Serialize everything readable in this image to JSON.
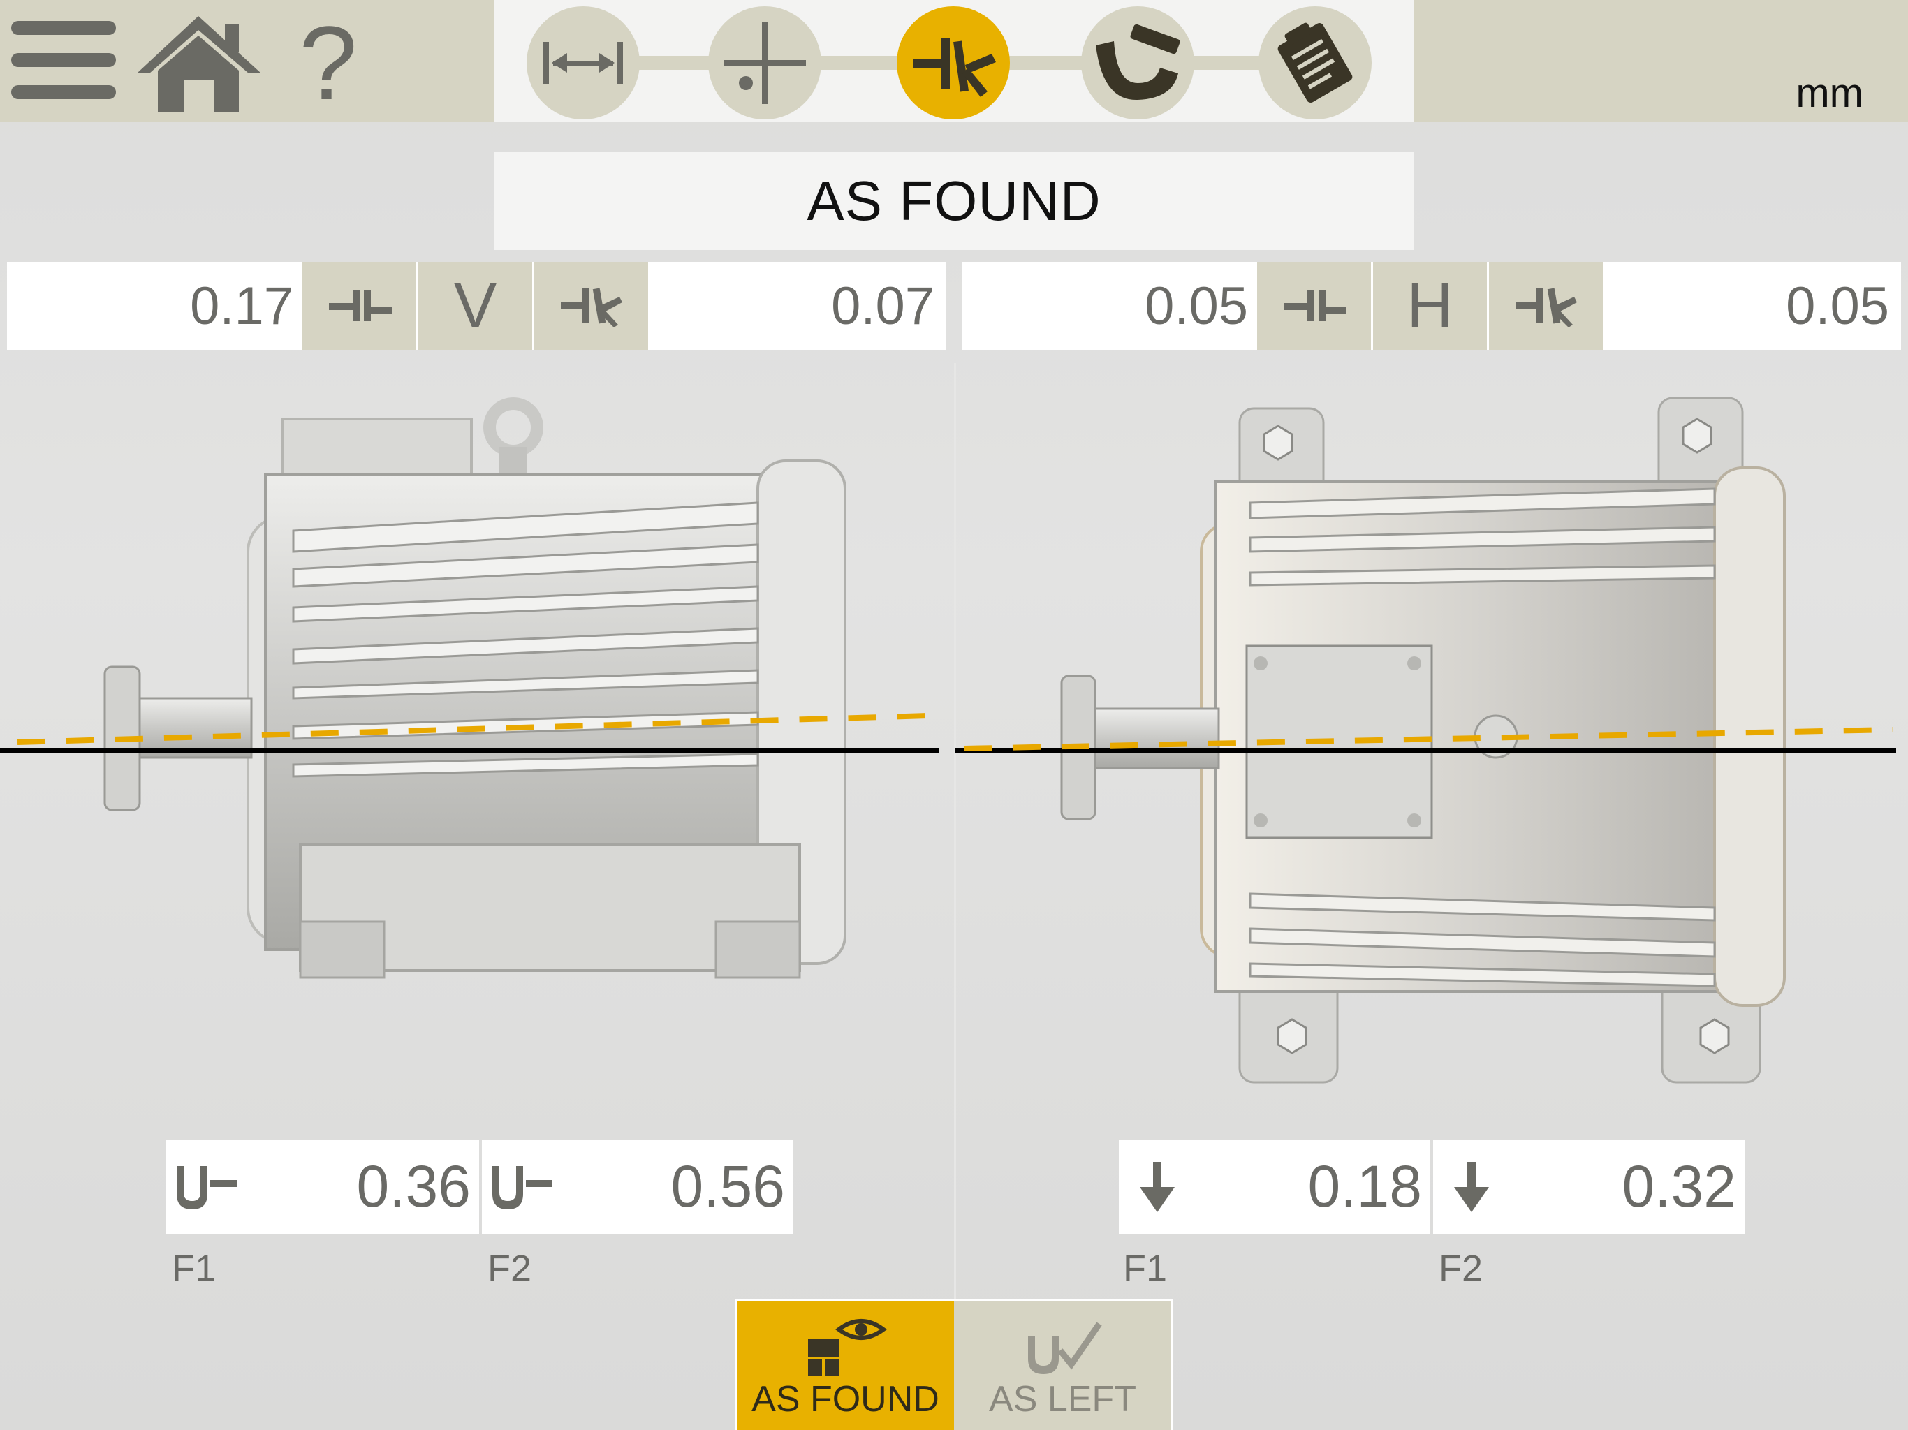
{
  "header": {
    "help_glyph": "?",
    "unit": "mm",
    "steps": [
      {
        "id": "dimensions",
        "icon": "dimension-arrows-icon",
        "active": false
      },
      {
        "id": "measure",
        "icon": "crosshair-icon",
        "active": false
      },
      {
        "id": "results",
        "icon": "alignment-result-icon",
        "active": true
      },
      {
        "id": "shims",
        "icon": "shim-icon",
        "active": false
      },
      {
        "id": "report",
        "icon": "report-icon",
        "active": false
      }
    ]
  },
  "mode_banner": "AS FOUND",
  "vertical": {
    "label": "V",
    "offset_value": "0.17",
    "angle_value": "0.07"
  },
  "horizontal": {
    "label": "H",
    "offset_value": "0.05",
    "angle_value": "0.05"
  },
  "feet_vertical": [
    {
      "label": "F1",
      "value": "0.36",
      "icon": "shim-foot-icon"
    },
    {
      "label": "F2",
      "value": "0.56",
      "icon": "shim-foot-icon"
    }
  ],
  "feet_horizontal": [
    {
      "label": "F1",
      "value": "0.18",
      "icon": "arrow-down-icon"
    },
    {
      "label": "F2",
      "value": "0.32",
      "icon": "arrow-down-icon"
    }
  ],
  "toggle": {
    "as_found": "AS FOUND",
    "as_left": "AS LEFT",
    "selected": "as_found"
  },
  "colors": {
    "accent": "#e8b100",
    "panel": "#d6d4c3",
    "dashed_line": "#e8a800",
    "reference_line": "#000000"
  }
}
